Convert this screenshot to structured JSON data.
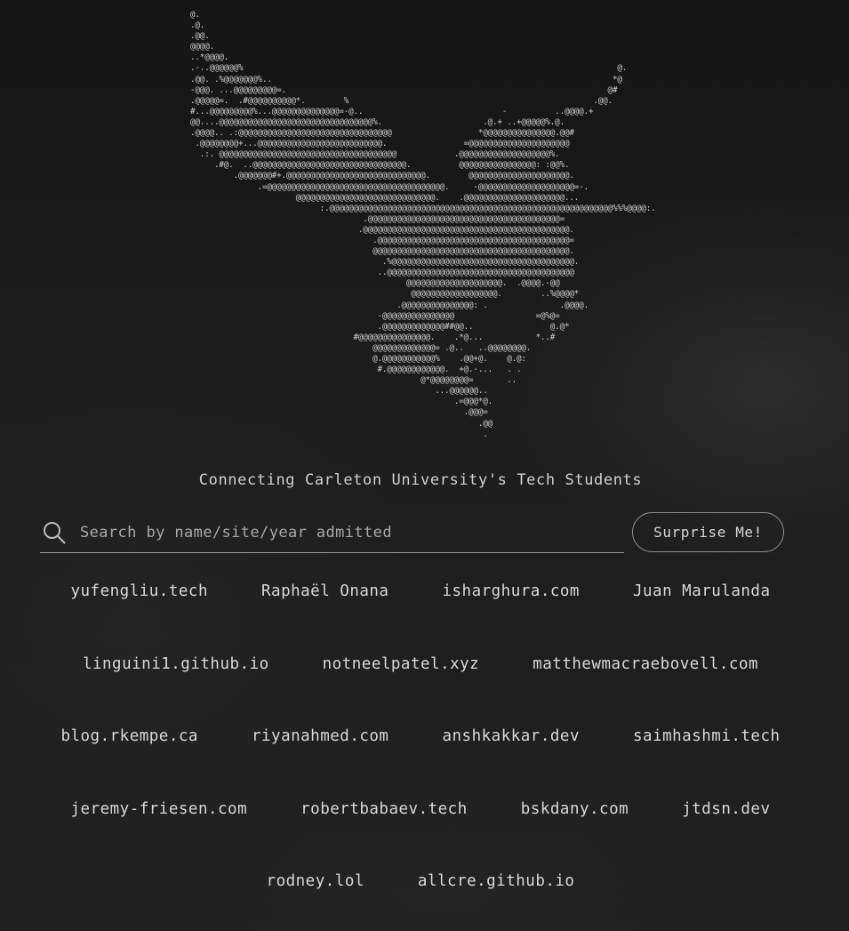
{
  "ascii_art": "@.\n.@.\n.@@.\n@@@@.\n..*@@@@.                                                            \n.-..@@@@@@%                                                                              @.\n.@@. .%@@@@@@@%..                                                                       *@\n-@@@. ...@@@@@@@@@=.                                                                   @#\n.@@@@@=.  .#@@@@@@@@@@*.        %                                                   .@@.\n#...@@@@@@@@@%...@@@@@@@@@@@@@@=-@..                             -          ..@@@@.+\n@@....@@@@@@@@@@@@@@@@@@@@@@@@@@@@@@@@%.                     .@.+ ..+@@@@@%.@.\n.@@@@.. .:@@@@@@@@@@@@@@@@@@@@@@@@@@@@@@@@                  *@@@@@@@@@@@@@@@.@@#\n .@@@@@@@@+...@@@@@@@@@@@@@@@@@@@@@@@@@@.                =@@@@@@@@@@@@@@@@@@@@@\n  .:. @@@@@@@@@@@@@@@@@@@@@@@@@@@@@@@@@@@@@            .@@@@@@@@@@@@@@@@@@@%.\n     .#@.  ..@@@@@@@@@@@@@@@@@@@@@@@@@@@@@@@@.          @@@@@@@@@@@@@@@@: :@@%.\n         .@@@@@@@#+.@@@@@@@@@@@@@@@@@@@@@@@@@@@@@.        @@@@@@@@@@@@@@@@@@@@@.\n              .=@@@@@@@@@@@@@@@@@@@@@@@@@@@@@@@@@@@@@.     -@@@@@@@@@@@@@@@@@@@@=-.\n                      @@@@@@@@@@@@@@@@@@@@@@@@@@@@@.    .@@@@@@@@@@@@@@@@@@@@@...\n                           :.@@@@@@@@@@@@@@@@@@@@@@@@@@@@@@@@@@@@@@@@@@@@@@@@@@@@@@@@@@@%%%@@@@:.\n                                    .@@@@@@@@@@@@@@@@@@@@@@@@@@@@@@@@@@@@@@@@=\n                                   .@@@@@@@@@@@@@@@@@@@@@@@@@@@@@@@@@@@@@@@@@@@.\n                                      .@@@@@@@@@@@@@@@@@@@@@@@@@@@@@@@@@@@@@@@@=\n                                      @@@@@@@@@@@@@@@@@@@@@@@@@@@@@@@@@@@@@@@@@.\n                                        .%@@@@@@@@@@@@@@@@@@@@@@@@@@@@@@@@@@@@@@.\n                                       ..@@@@@@@@@@@@@@@@@@@@@@@@@@@@@@@@@@@@@@@\n                                             @@@@@@@@@@@@@@@@@@@@.  .@@@@.-@@\n                                              @@@@@@@@@@@@@@@@@@.        ..%@@@@*\n                                           .@@@@@@@@@@@@@@@: .               .@@@@.\n                                       -@@@@@@@@@@@@@@@                 =@%@=\n                                       .@@@@@@@@@@@@@##@@..                @.@*\n                                  #@@@@@@@@@@@@@@@.    .*@...           *..#\n                                      @@@@@@@@@@@@@= .@..   ..@@@@@@@@.\n                                      @.@@@@@@@@@@@%    .@@+@.    @.@:\n                                       #.@@@@@@@@@@@@.  +@.-...   . .\n                                                @*@@@@@@@@=       ..\n                                                   ...@@@@@@..\n                                                       .=@@@*@.\n                                                         .@@@=\n                                                            .@@\n                                                             .",
  "tagline": "Connecting Carleton University's Tech Students",
  "search": {
    "placeholder": "Search by name/site/year admitted",
    "icon": "search-icon"
  },
  "surprise_button": "Surprise Me!",
  "link_rows": [
    [
      "yufengliu.tech",
      "Raphaël Onana",
      "isharghura.com",
      "Juan Marulanda"
    ],
    [
      "linguini1.github.io",
      "notneelpatel.xyz",
      "matthewmacraebovell.com"
    ],
    [
      "blog.rkempe.ca",
      "riyanahmed.com",
      "anshkakkar.dev",
      "saimhashmi.tech"
    ],
    [
      "jeremy-friesen.com",
      "robertbabaev.tech",
      "bskdany.com",
      "jtdsn.dev"
    ],
    [
      "rodney.lol",
      "allcre.github.io"
    ]
  ],
  "colors": {
    "background": "#1c1c1c",
    "text": "#d6d6d6",
    "border": "#9a9a9a"
  }
}
